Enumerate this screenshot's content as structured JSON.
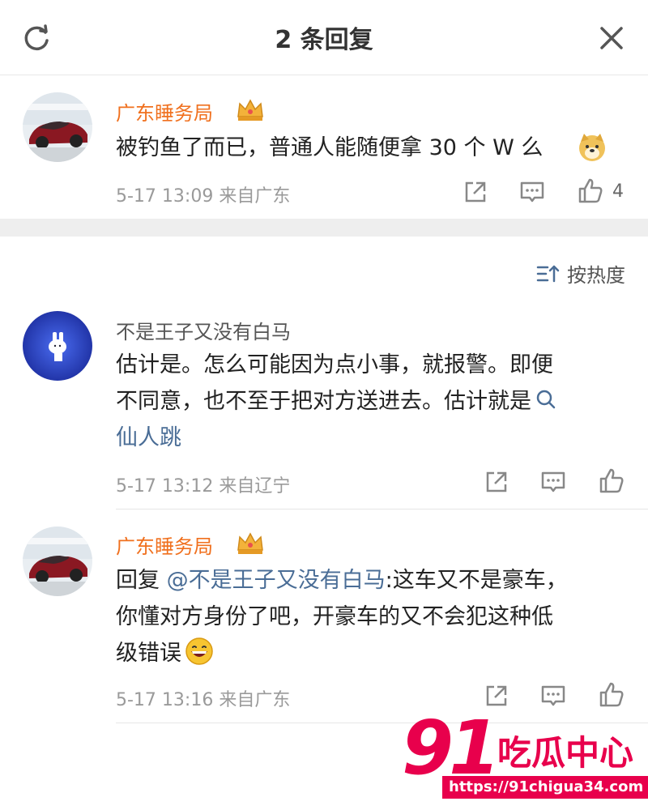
{
  "header": {
    "title": "2 条回复"
  },
  "root_comment": {
    "username": "广东睡务局",
    "text": "被钓鱼了而已，普通人能随便拿 30 个 W 么",
    "meta": "5-17 13:09  来自广东",
    "like_count": "4"
  },
  "sort": {
    "label": "按热度"
  },
  "replies": [
    {
      "username": "不是王子又没有白马",
      "text_main": "估计是。怎么可能因为点小事，就报警。即便",
      "text_line2": "不同意，也不至于把对方送进去。估计就是",
      "search_link": "仙人跳",
      "meta": "5-17 13:12  来自辽宁"
    },
    {
      "username": "广东睡务局",
      "reply_prefix": "回复 ",
      "mention": "@不是王子又没有白马",
      "text_line1": ":这车又不是豪车，",
      "text_line2": "你懂对方身份了吧，开豪车的又不会犯这种低",
      "text_line3": "级错误",
      "meta": "5-17 13:16  来自广东"
    }
  ],
  "watermark": {
    "number": "91",
    "text": "吃瓜中心",
    "url": "https://91chigua34.com"
  },
  "colors": {
    "orange_name": "#f0701e",
    "link_blue": "#4a6d96",
    "meta_gray": "#9a9a9a",
    "brand_red": "#e8004c"
  }
}
